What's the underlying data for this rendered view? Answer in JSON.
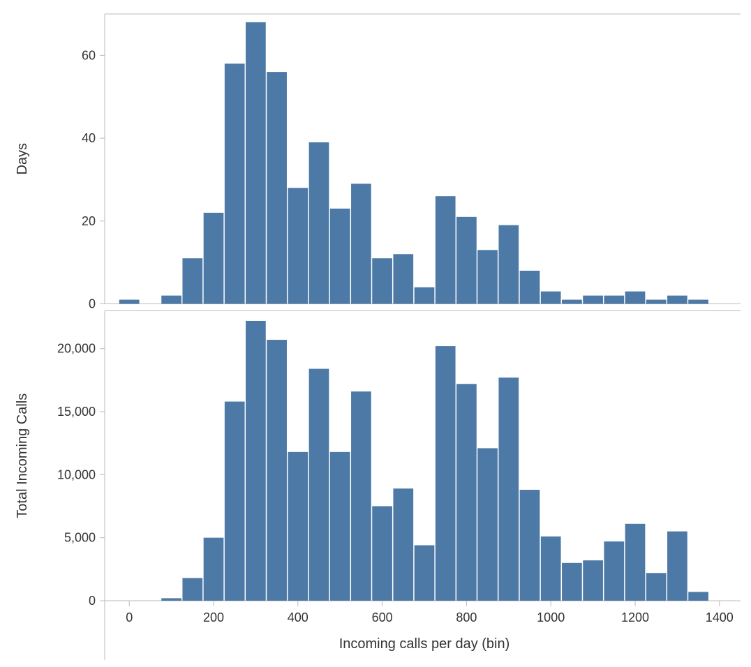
{
  "chart_data": [
    {
      "type": "bar",
      "title": "",
      "xlabel": "Incoming calls per day (bin)",
      "ylabel": "Days",
      "ylim": [
        0,
        70
      ],
      "xlim": [
        -50,
        1450
      ],
      "categories": [
        0,
        50,
        100,
        150,
        200,
        250,
        300,
        350,
        400,
        450,
        500,
        550,
        600,
        650,
        700,
        750,
        800,
        850,
        900,
        950,
        1000,
        1050,
        1100,
        1150,
        1200,
        1250,
        1300,
        1350
      ],
      "values": [
        1,
        0,
        2,
        11,
        22,
        58,
        68,
        56,
        28,
        39,
        23,
        29,
        11,
        12,
        4,
        26,
        21,
        13,
        19,
        8,
        3,
        1,
        2,
        2,
        3,
        1,
        2,
        1
      ],
      "y_ticks": [
        0,
        20,
        40,
        60
      ]
    },
    {
      "type": "bar",
      "title": "",
      "xlabel": "Incoming calls per day (bin)",
      "ylabel": "Total Incoming Calls",
      "ylim": [
        0,
        23000
      ],
      "xlim": [
        -50,
        1450
      ],
      "categories": [
        0,
        50,
        100,
        150,
        200,
        250,
        300,
        350,
        400,
        450,
        500,
        550,
        600,
        650,
        700,
        750,
        800,
        850,
        900,
        950,
        1000,
        1050,
        1100,
        1150,
        1200,
        1250,
        1300,
        1350
      ],
      "values": [
        0,
        0,
        200,
        1800,
        5000,
        15800,
        22200,
        20700,
        11800,
        18400,
        11800,
        16600,
        7500,
        8900,
        4400,
        20200,
        17200,
        12100,
        17700,
        8800,
        5100,
        3000,
        3200,
        4700,
        6100,
        2200,
        5500,
        700
      ],
      "y_ticks": [
        0,
        5000,
        10000,
        15000,
        20000
      ]
    }
  ],
  "shared_x_ticks": [
    0,
    200,
    400,
    600,
    800,
    1000,
    1200,
    1400
  ],
  "shared_x_label": "Incoming calls per day (bin)",
  "bar_color": "#4d79a6"
}
